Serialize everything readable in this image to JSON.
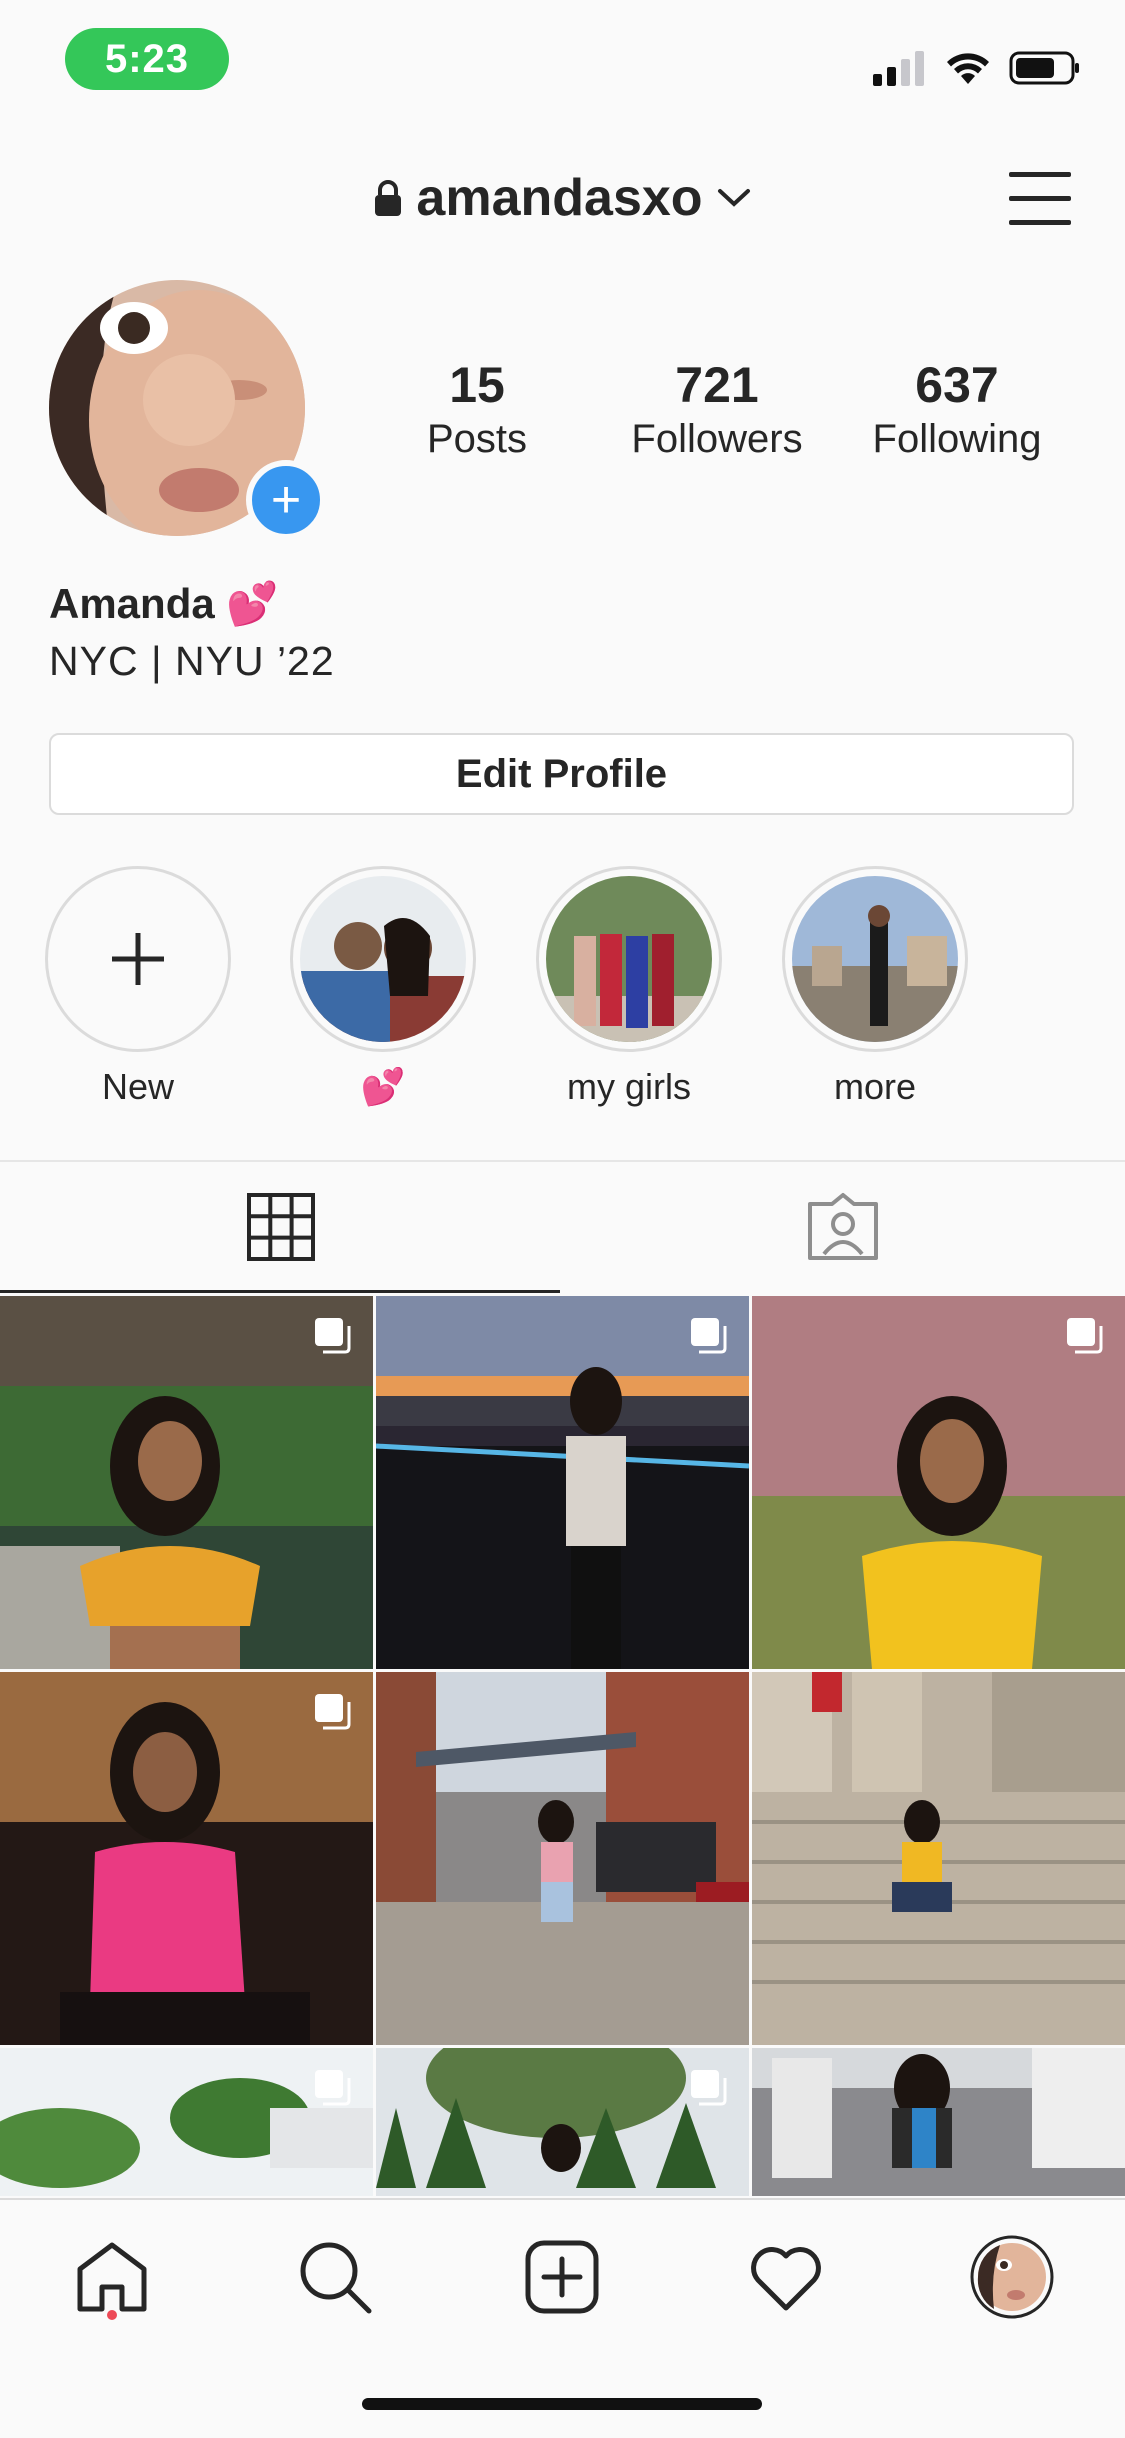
{
  "status_bar": {
    "time": "5:23"
  },
  "header": {
    "username": "amandasxo"
  },
  "profile": {
    "stats": [
      {
        "value": "15",
        "label": "Posts"
      },
      {
        "value": "721",
        "label": "Followers"
      },
      {
        "value": "637",
        "label": "Following"
      }
    ],
    "name": "Amanda 💕",
    "bio": "NYC | NYU ’22",
    "edit_button": "Edit Profile"
  },
  "highlights": [
    {
      "label": "New"
    },
    {
      "label": "💕"
    },
    {
      "label": "my girls"
    },
    {
      "label": "more"
    }
  ],
  "colors": {
    "accent": "#3897f0",
    "status_pill": "#34c759",
    "notification_dot": "#ed4956"
  }
}
